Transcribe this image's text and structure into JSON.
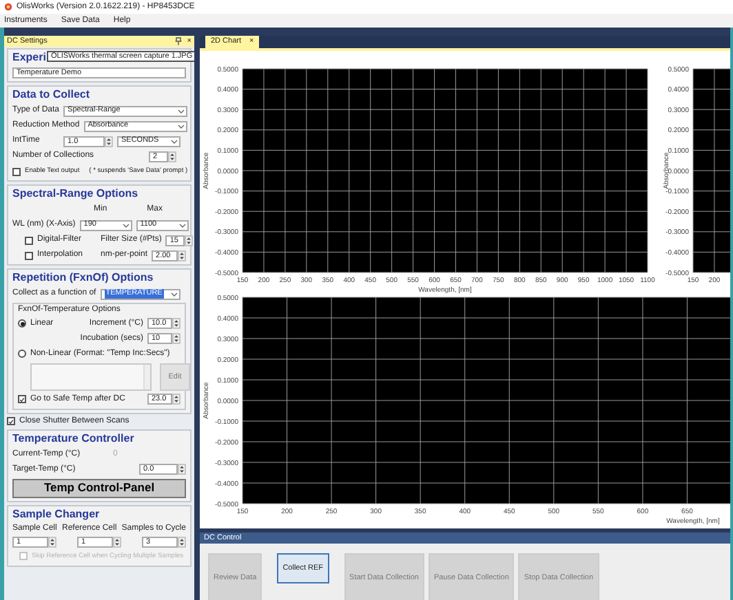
{
  "window": {
    "title": "OlisWorks (Version 2.0.1622.219) - HP8453DCE"
  },
  "menu": [
    "Instruments",
    "Save Data",
    "Help"
  ],
  "settings_panel": {
    "title": "DC Settings",
    "close": "×"
  },
  "experiment": {
    "heading": "Experi",
    "name": "Temperature Demo"
  },
  "tooltip": "OLISWorks thermal screen capture 1.JPG",
  "data_to_collect": {
    "heading": "Data to Collect",
    "type_label": "Type of Data",
    "type_value": "Spectral-Range",
    "reduction_label": "Reduction Method",
    "reduction_value": "Absorbance",
    "inttime_label": "IntTime",
    "inttime_value": "1.0",
    "inttime_unit": "SECONDS",
    "collections_label": "Number of Collections",
    "collections_value": "2",
    "text_output": {
      "label": "Enable Text output",
      "checked": false
    },
    "text_output_note": "( * suspends 'Save Data' prompt )"
  },
  "spectral_range": {
    "heading": "Spectral-Range Options",
    "min_label": "Min",
    "max_label": "Max",
    "wl_label": "WL (nm) (X-Axis)",
    "wl_min": "190",
    "wl_max": "1100",
    "digital_filter": {
      "label": "Digital-Filter",
      "checked": false
    },
    "filter_size_label": "Filter Size (#Pts)",
    "filter_size": "15",
    "interpolation": {
      "label": "Interpolation",
      "checked": false
    },
    "nm_per_point_label": "nm-per-point",
    "nm_per_point": "2.00"
  },
  "repetition": {
    "heading": "Repetition (FxnOf) Options",
    "function_label": "Collect as a function of",
    "function_value": "TEMPERATURE",
    "function_highlighted": true
  },
  "fxnof": {
    "title": "FxnOf-Temperature Options",
    "linear": {
      "label": "Linear",
      "selected": true
    },
    "increment_label": "Increment (°C)",
    "increment": "10.0",
    "incubation_label": "Incubation (secs)",
    "incubation": "10",
    "nonlinear": {
      "label": "Non-Linear (Format: \"Temp Inc:Secs\")",
      "selected": false
    },
    "edit_button": "Edit",
    "safe_temp": {
      "label": "Go to Safe Temp after DC",
      "checked": true
    },
    "safe_temp_value": "23.0"
  },
  "close_shutter": {
    "label": "Close Shutter Between Scans",
    "checked": true
  },
  "temperature_controller": {
    "heading": "Temperature Controller",
    "current_label": "Current-Temp (°C)",
    "current_value": "0",
    "target_label": "Target-Temp (°C)",
    "target_value": "0.0",
    "panel_button": "Temp Control-Panel"
  },
  "sample_changer": {
    "heading": "Sample Changer",
    "fields": [
      {
        "label": "Sample Cell",
        "value": "1"
      },
      {
        "label": "Reference Cell",
        "value": "1"
      },
      {
        "label": "Samples to Cycle",
        "value": "3"
      }
    ],
    "skip_reference": {
      "label": "Skip Reference Cell when Cycling Multiple Samples",
      "checked": false,
      "disabled": true
    }
  },
  "tabs": [
    {
      "label": "2D Chart",
      "close": "×",
      "selected": true
    }
  ],
  "charts": [
    {
      "chart_data": {
        "type": "line",
        "grid": true,
        "xlabel": "Wavelength, [nm]",
        "ylabel": "Absorbance",
        "xlim": [
          150,
          1100
        ],
        "ylim": [
          -0.5,
          0.5
        ],
        "xticks": [
          150,
          200,
          250,
          300,
          350,
          400,
          450,
          500,
          550,
          600,
          650,
          700,
          750,
          800,
          850,
          900,
          950,
          1000,
          1050,
          1100
        ],
        "yticks": [
          {
            "value": 0.5,
            "label": "0.5000"
          },
          {
            "value": 0.4,
            "label": "0.4000"
          },
          {
            "value": 0.3,
            "label": "0.3000"
          },
          {
            "value": 0.2,
            "label": "0.2000"
          },
          {
            "value": 0.1,
            "label": "0.1000"
          },
          {
            "value": 0,
            "label": "0.0000"
          },
          {
            "value": -0.1,
            "label": "-0.1000"
          },
          {
            "value": -0.2,
            "label": "-0.2000"
          },
          {
            "value": -0.3,
            "label": "-0.3000"
          },
          {
            "value": -0.4,
            "label": "-0.4000"
          },
          {
            "value": -0.5,
            "label": "-0.5000"
          }
        ]
      }
    },
    {
      "chart_data": {
        "type": "line",
        "grid": true,
        "ylabel": "Absorbance",
        "xlim": [
          150,
          240
        ],
        "ylim": [
          -0.5,
          0.5
        ],
        "xticks": [
          150,
          200
        ],
        "yticks": [
          {
            "value": 0.5,
            "label": "0.5000"
          },
          {
            "value": 0.4,
            "label": "0.4000"
          },
          {
            "value": 0.3,
            "label": "0.3000"
          },
          {
            "value": 0.2,
            "label": "0.2000"
          },
          {
            "value": 0.1,
            "label": "0.1000"
          },
          {
            "value": 0,
            "label": "0.0000"
          },
          {
            "value": -0.1,
            "label": "-0.1000"
          },
          {
            "value": -0.2,
            "label": "-0.2000"
          },
          {
            "value": -0.3,
            "label": "-0.3000"
          },
          {
            "value": -0.4,
            "label": "-0.4000"
          },
          {
            "value": -0.5,
            "label": "-0.5000"
          }
        ]
      }
    },
    {
      "chart_data": {
        "type": "line",
        "grid": true,
        "xlabel": "Wavelength, [nm]",
        "ylabel": "Absorbance",
        "xlim": [
          150,
          700
        ],
        "ylim": [
          -0.5,
          0.5
        ],
        "xticks": [
          150,
          200,
          250,
          300,
          350,
          400,
          450,
          500,
          550,
          600,
          650
        ],
        "yticks": [
          {
            "value": 0.5,
            "label": "0.5000"
          },
          {
            "value": 0.4,
            "label": "0.4000"
          },
          {
            "value": 0.3,
            "label": "0.3000"
          },
          {
            "value": 0.2,
            "label": "0.2000"
          },
          {
            "value": 0.1,
            "label": "0.1000"
          },
          {
            "value": 0,
            "label": "0.0000"
          },
          {
            "value": -0.1,
            "label": "-0.1000"
          },
          {
            "value": -0.2,
            "label": "-0.2000"
          },
          {
            "value": -0.3,
            "label": "-0.3000"
          },
          {
            "value": -0.4,
            "label": "-0.4000"
          },
          {
            "value": -0.5,
            "label": "-0.5000"
          }
        ]
      }
    }
  ],
  "dc_control": {
    "title": "DC Control",
    "buttons": [
      {
        "label": "Review Data",
        "disabled": true
      },
      {
        "label": "Collect REF",
        "disabled": false
      },
      {
        "label": "Start Data Collection",
        "disabled": true
      },
      {
        "label": "Pause Data Collection",
        "disabled": true
      },
      {
        "label": "Stop Data Collection",
        "disabled": true
      }
    ]
  }
}
